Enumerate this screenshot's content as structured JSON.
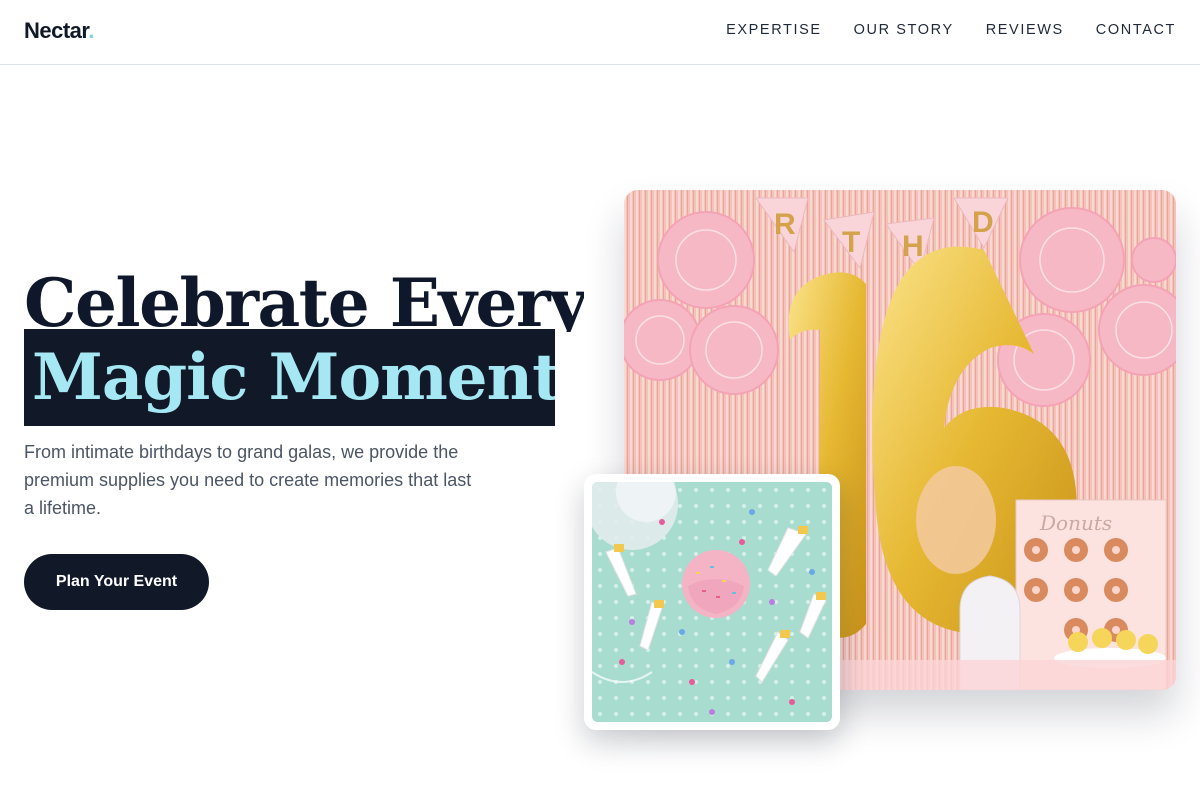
{
  "brand": {
    "name": "Nectar",
    "dot": ".",
    "accent": "#7dd3e0"
  },
  "nav": {
    "items": [
      {
        "label": "EXPERTISE"
      },
      {
        "label": "OUR STORY"
      },
      {
        "label": "REVIEWS"
      },
      {
        "label": "CONTACT"
      }
    ]
  },
  "hero": {
    "title_line1": "Celebrate Every",
    "title_line2": "Magic Moment.",
    "subtitle": "From intimate birthdays to grand galas, we provide the premium supplies you need to create memories that last a lifetime.",
    "cta_label": "Plan Your Event"
  },
  "images": {
    "main_banner_letters": [
      "R",
      "T",
      "H",
      "D"
    ],
    "main_balloon_number": "16",
    "main_donut_sign": "Donuts"
  },
  "colors": {
    "dark": "#111827",
    "highlight_text": "#a5e7f2",
    "subtitle_text": "#4b5563"
  }
}
